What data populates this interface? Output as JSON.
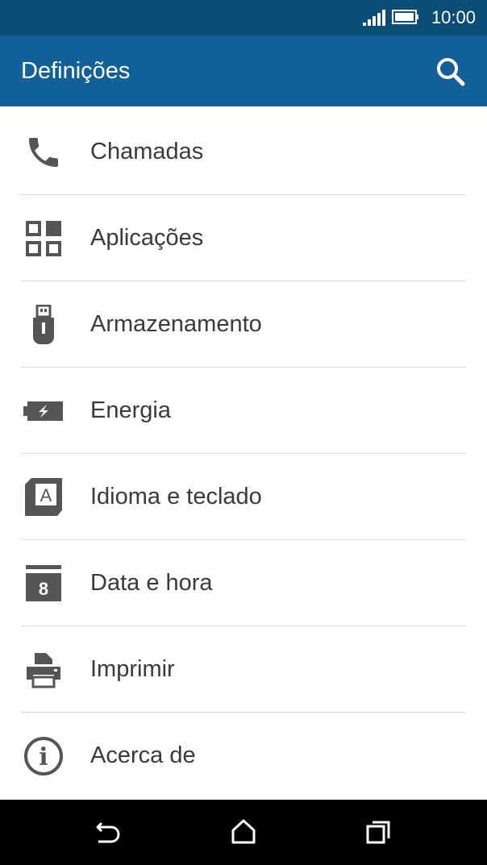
{
  "status_bar": {
    "time": "10:00",
    "icons": [
      "signal-icon",
      "battery-icon"
    ]
  },
  "app_bar": {
    "title": "Definições",
    "search_icon": "search-icon"
  },
  "settings": [
    {
      "label": "Chamadas",
      "icon": "phone-icon"
    },
    {
      "label": "Aplicações",
      "icon": "apps-grid-icon"
    },
    {
      "label": "Armazenamento",
      "icon": "usb-storage-icon"
    },
    {
      "label": "Energia",
      "icon": "battery-charging-icon"
    },
    {
      "label": "Idioma e teclado",
      "icon": "language-keyboard-icon"
    },
    {
      "label": "Data e hora",
      "icon": "calendar-icon",
      "icon_text": "8"
    },
    {
      "label": "Imprimir",
      "icon": "printer-icon"
    },
    {
      "label": "Acerca de",
      "icon": "info-icon",
      "icon_text": "i"
    }
  ],
  "navigation": [
    "back-icon",
    "home-icon",
    "recents-icon"
  ],
  "colors": {
    "status_bar": "#0c4d78",
    "app_bar": "#11609a",
    "icon": "#555555",
    "text": "#3a3a3a",
    "divider": "#dcdcdc",
    "nav_bar": "#000000"
  }
}
